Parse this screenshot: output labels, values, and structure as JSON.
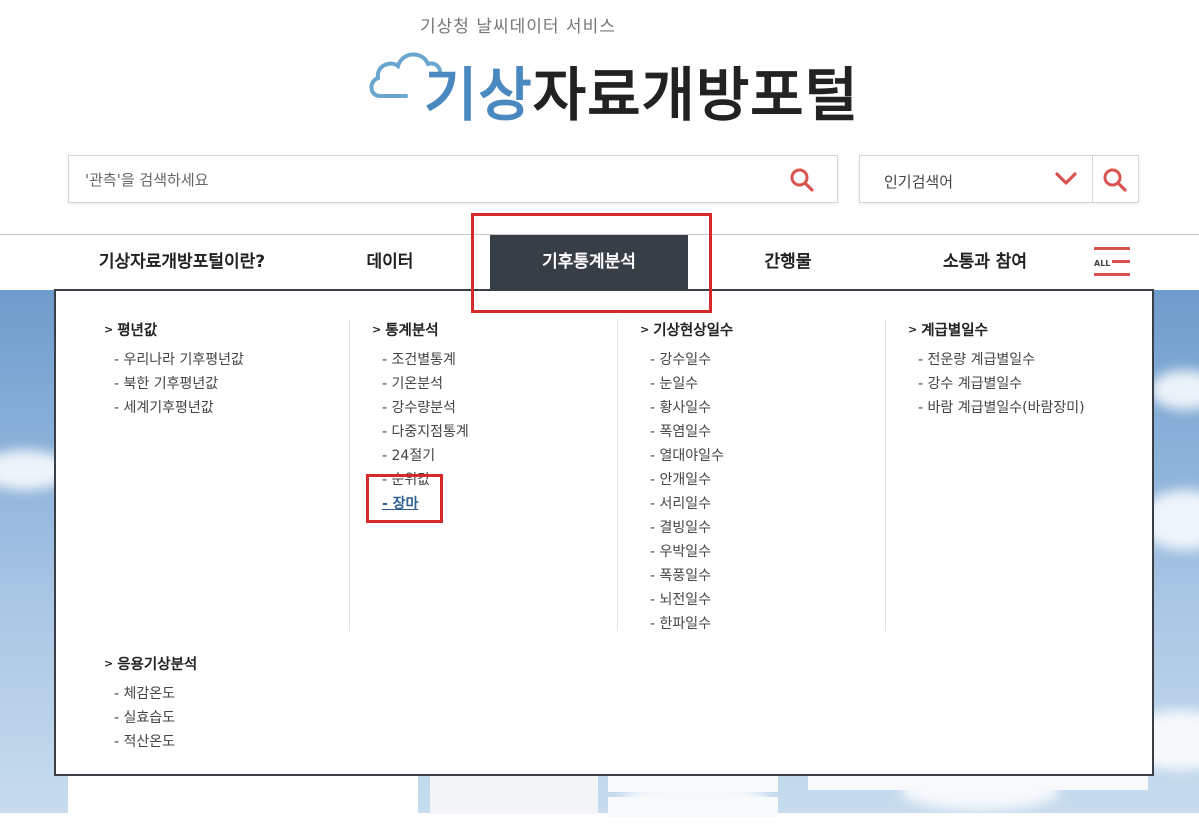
{
  "header": {
    "tagline": "기상청 날씨데이터 서비스",
    "logo_part1": "기상",
    "logo_part2": "자료개방포털"
  },
  "search": {
    "placeholder": "'관측'을 검색하세요"
  },
  "popular": {
    "label": "인기검색어"
  },
  "nav": {
    "items": [
      {
        "label": "기상자료개방포털이란?"
      },
      {
        "label": "데이터"
      },
      {
        "label": "기후통계분석"
      },
      {
        "label": "간행물"
      },
      {
        "label": "소통과 참여"
      }
    ],
    "active_index": 2,
    "all_label": "ALL"
  },
  "menu": {
    "columns": [
      {
        "title": "평년값",
        "items": [
          "- 우리나라 기후평년값",
          "- 북한 기후평년값",
          "- 세계기후평년값"
        ]
      },
      {
        "title": "통계분석",
        "items": [
          "- 조건별통계",
          "- 기온분석",
          "- 강수량분석",
          "- 다중지점통계",
          "- 24절기",
          "- 순위값",
          "- 장마"
        ]
      },
      {
        "title": "기상현상일수",
        "items": [
          "- 강수일수",
          "- 눈일수",
          "- 황사일수",
          "- 폭염일수",
          "- 열대야일수",
          "- 안개일수",
          "- 서리일수",
          "- 결빙일수",
          "- 우박일수",
          "- 폭풍일수",
          "- 뇌전일수",
          "- 한파일수"
        ]
      },
      {
        "title": "계급별일수",
        "items": [
          "- 전운량 계급별일수",
          "- 강수 계급별일수",
          "- 바람 계급별일수(바람장미)"
        ]
      }
    ],
    "bottom_group": {
      "title": "응용기상분석",
      "items": [
        "- 체감온도",
        "- 실효습도",
        "- 적산온도"
      ]
    }
  },
  "colors": {
    "accent_red": "#d9534f",
    "active_nav_bg": "#373e46",
    "logo_blue": "#4a88c0",
    "highlight_red": "#d42a2a"
  }
}
